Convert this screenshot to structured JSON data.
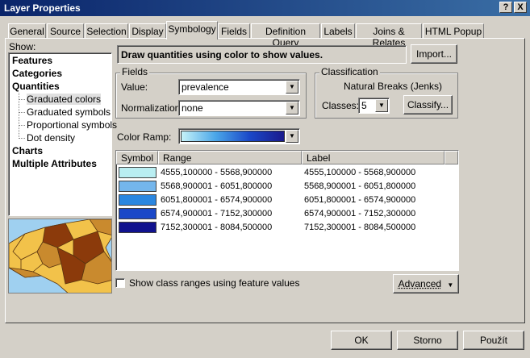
{
  "window": {
    "title": "Layer Properties",
    "help_label": "?",
    "close_label": "X"
  },
  "tabs": [
    {
      "label": "General"
    },
    {
      "label": "Source"
    },
    {
      "label": "Selection"
    },
    {
      "label": "Display"
    },
    {
      "label": "Symbology",
      "active": true
    },
    {
      "label": "Fields"
    },
    {
      "label": "Definition Query"
    },
    {
      "label": "Labels"
    },
    {
      "label": "Joins & Relates"
    },
    {
      "label": "HTML Popup"
    }
  ],
  "show": {
    "label": "Show:",
    "items": [
      {
        "label": "Features",
        "bold": true
      },
      {
        "label": "Categories",
        "bold": true
      },
      {
        "label": "Quantities",
        "bold": true
      },
      {
        "label": "Graduated colors",
        "selected": true
      },
      {
        "label": "Graduated symbols"
      },
      {
        "label": "Proportional symbols"
      },
      {
        "label": "Dot density"
      },
      {
        "label": "Charts",
        "bold": true
      },
      {
        "label": "Multiple Attributes",
        "bold": true
      }
    ]
  },
  "description": "Draw quantities using color to show values.",
  "import_label": "Import...",
  "fields": {
    "group_label": "Fields",
    "value_label": "Value:",
    "value": "prevalence",
    "normalization_label": "Normalization:",
    "normalization": "none"
  },
  "classification": {
    "group_label": "Classification",
    "method": "Natural Breaks (Jenks)",
    "classes_label": "Classes:",
    "classes": "5",
    "classify_label": "Classify..."
  },
  "color_ramp": {
    "label": "Color Ramp:",
    "from": "#c6f2f8",
    "to": "#1a1a8c"
  },
  "table": {
    "headers": [
      "Symbol",
      "Range",
      "Label"
    ],
    "rows": [
      {
        "color": "#b9eef2",
        "range": "4555,100000 - 5568,900000",
        "label": "4555,100000 - 5568,900000"
      },
      {
        "color": "#74b6ec",
        "range": "5568,900001 - 6051,800000",
        "label": "5568,900001 - 6051,800000"
      },
      {
        "color": "#2b87e0",
        "range": "6051,800001 - 6574,900000",
        "label": "6051,800001 - 6574,900000"
      },
      {
        "color": "#1a48c8",
        "range": "6574,900001 - 7152,300000",
        "label": "6574,900001 - 7152,300000"
      },
      {
        "color": "#10128e",
        "range": "7152,300001 - 8084,500000",
        "label": "7152,300001 - 8084,500000"
      }
    ]
  },
  "show_class_ranges_label": "Show class ranges using feature values",
  "advanced_label": "Advanced",
  "buttons": {
    "ok": "OK",
    "cancel": "Storno",
    "apply": "Použít"
  },
  "map_colors": {
    "sea": "#9fd0f0",
    "land_dark": "#8b3a0b",
    "land_mid": "#c98a2e",
    "land_light": "#f2c24a"
  }
}
